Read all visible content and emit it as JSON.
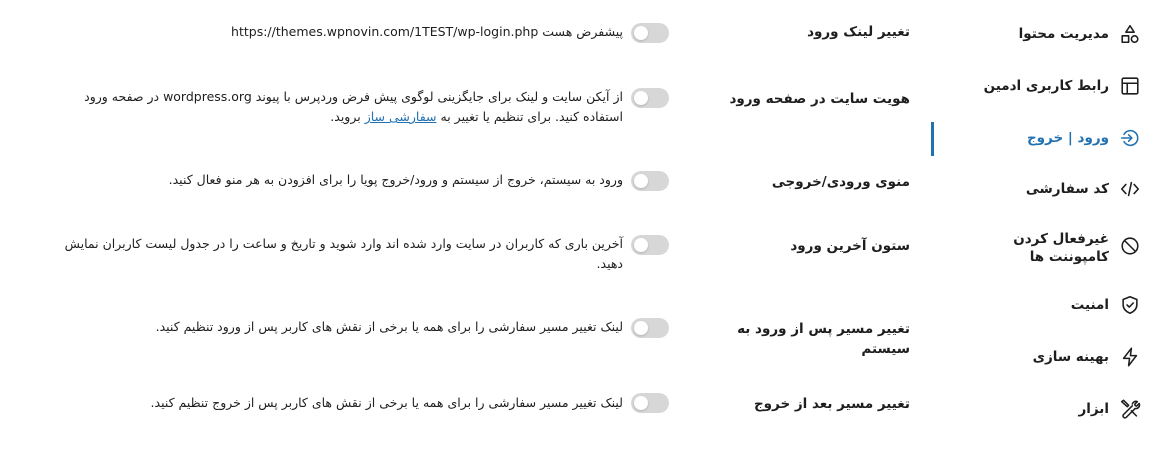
{
  "sidebar": {
    "items": [
      {
        "label": "مدیریت محتوا",
        "icon": "shapes-icon",
        "active": false
      },
      {
        "label": "رابط کاربری ادمین",
        "icon": "layout-icon",
        "active": false
      },
      {
        "label": "ورود | خروج",
        "icon": "login-icon",
        "active": true
      },
      {
        "label": "کد سفارشی",
        "icon": "code-icon",
        "active": false
      },
      {
        "label": "غیرفعال کردن کامپوننت ها",
        "icon": "block-icon",
        "active": false
      },
      {
        "label": "امنیت",
        "icon": "shield-check-icon",
        "active": false
      },
      {
        "label": "بهینه سازی",
        "icon": "lightning-icon",
        "active": false
      },
      {
        "label": "ابزار",
        "icon": "tools-icon",
        "active": false
      }
    ],
    "accent_color": "#2271b1"
  },
  "settings": {
    "rows": [
      {
        "title": "تغییر لینک ورود",
        "enabled": false,
        "desc_prefix": "پیشفرض هست",
        "desc_url": "https://themes.wpnovin.com/1TEST/wp-login.php"
      },
      {
        "title": "هویت سایت در صفحه ورود",
        "enabled": false,
        "desc_before_link": "از آیکن سایت و لینک برای جایگزینی لوگوی پیش فرض وردپرس با پیوند wordpress.org در صفحه ورود استفاده کنید. برای تنظیم یا تغییر به",
        "desc_link": "سفارشی ساز",
        "desc_after_link": "بروید."
      },
      {
        "title": "منوی ورودی/خروجی",
        "enabled": false,
        "desc": "ورود به سیستم، خروج از سیستم و ورود/خروج پویا را برای افزودن به هر منو فعال کنید."
      },
      {
        "title": "ستون آخرین ورود",
        "enabled": false,
        "desc": "آخرین باری که کاربران در سایت وارد شده اند وارد شوید و تاریخ و ساعت را در جدول لیست کاربران نمایش دهید."
      },
      {
        "title": "تغییر مسیر پس از ورود به سیستم",
        "enabled": false,
        "desc": "لینک تغییر مسیر سفارشی را برای همه یا برخی از نقش های کاربر پس از ورود تنظیم کنید."
      },
      {
        "title": "تغییر مسیر بعد از خروج",
        "enabled": false,
        "desc": "لینک تغییر مسیر سفارشی را برای همه یا برخی از نقش های کاربر پس از خروج تنظیم کنید."
      }
    ],
    "toggle_off_color": "#d7d7d7"
  }
}
